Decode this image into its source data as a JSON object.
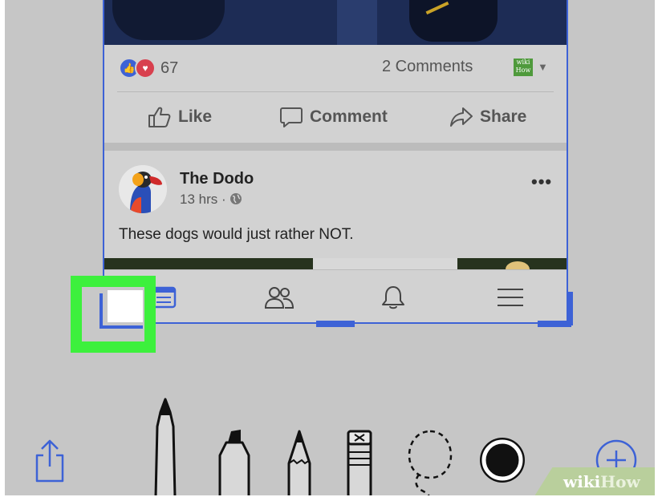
{
  "post": {
    "reaction_count": "67",
    "comments_count": "2 Comments",
    "page_avatar_text": "wiki How",
    "actions": {
      "like": "Like",
      "comment": "Comment",
      "share": "Share"
    }
  },
  "next_post": {
    "author": "The Dodo",
    "time": "13 hrs ·",
    "text": "These dogs would just rather NOT.",
    "more": "•••"
  },
  "tabbar": {
    "items": [
      "news-feed",
      "friends",
      "notifications",
      "menu"
    ]
  },
  "markup_tools": {
    "items": [
      "pen",
      "marker",
      "pencil",
      "eraser",
      "lasso",
      "color-picker"
    ],
    "selected_color": "#111111"
  },
  "watermark": {
    "wiki": "wiki",
    "how": "How"
  },
  "colors": {
    "accent_blue": "#3d62d6",
    "highlight_green": "#3df03d",
    "background_gray": "#c6c6c6"
  }
}
